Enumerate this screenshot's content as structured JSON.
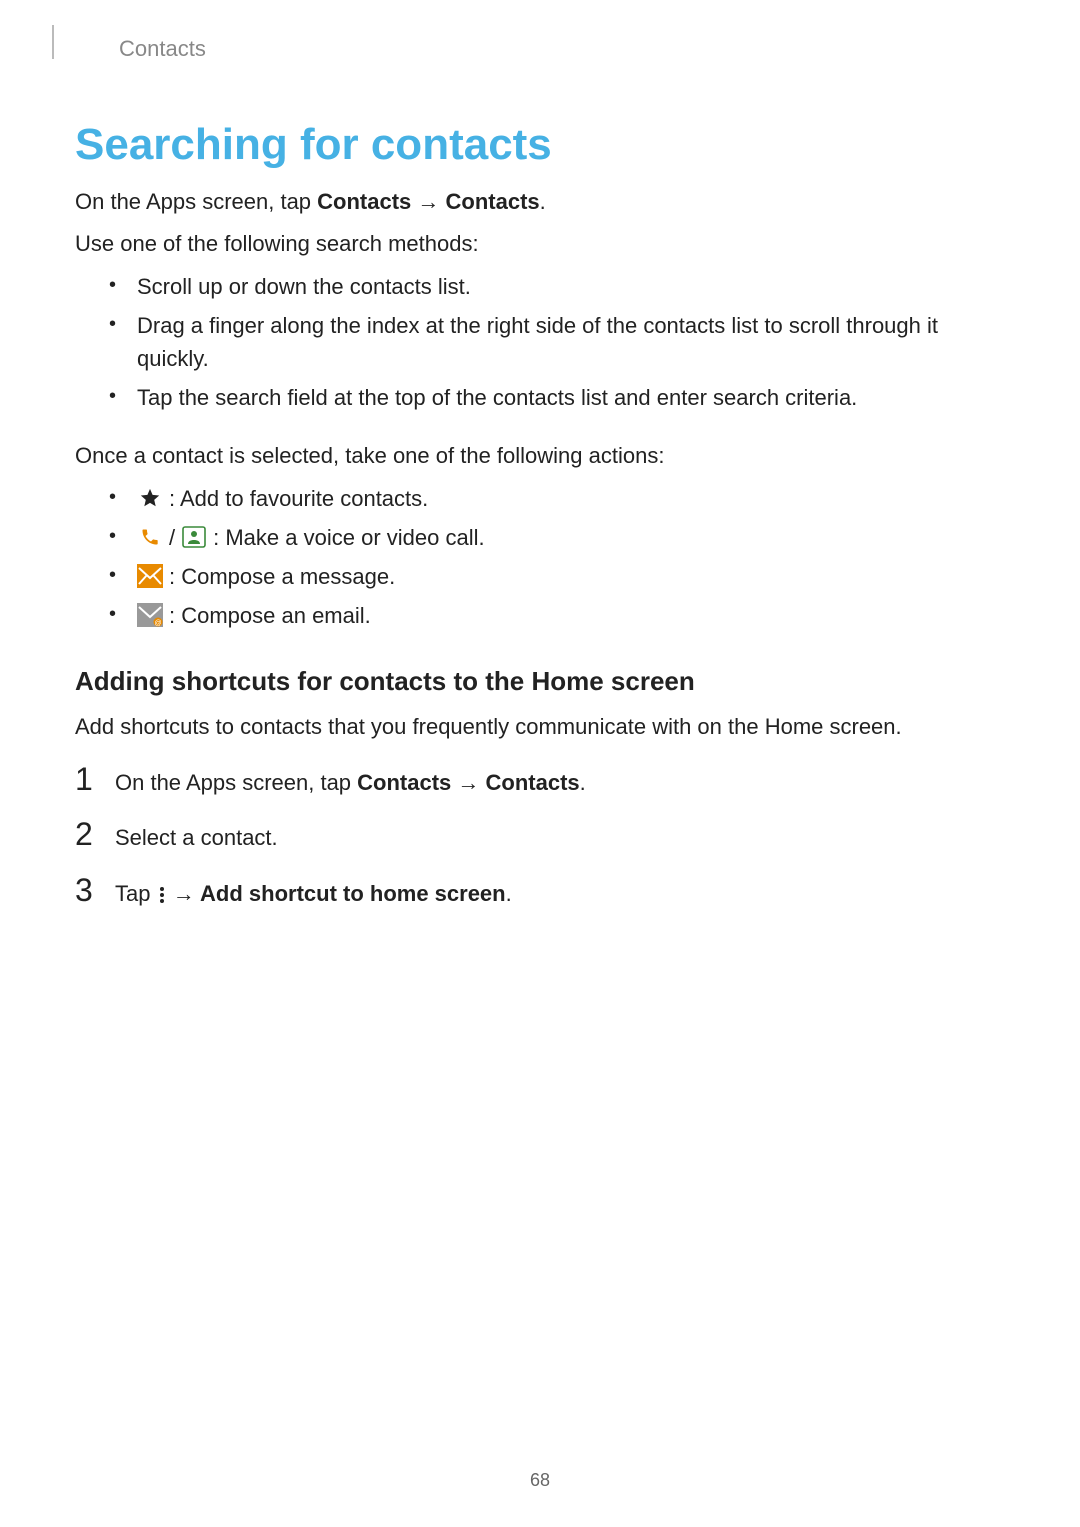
{
  "header": {
    "section": "Contacts"
  },
  "title": "Searching for contacts",
  "intro": {
    "line1_a": "On the Apps screen, tap ",
    "line1_b": "Contacts",
    "line1_c": " → ",
    "line1_d": "Contacts",
    "line1_e": ".",
    "line2": "Use one of the following search methods:"
  },
  "methods": [
    "Scroll up or down the contacts list.",
    "Drag a finger along the index at the right side of the contacts list to scroll through it quickly.",
    "Tap the search field at the top of the contacts list and enter search criteria."
  ],
  "actions_intro": "Once a contact is selected, take one of the following actions:",
  "actions": {
    "fav": " : Add to favourite contacts.",
    "call_sep": " / ",
    "call": " : Make a voice or video call.",
    "msg": " : Compose a message.",
    "email": " : Compose an email."
  },
  "subhead": "Adding shortcuts for contacts to the Home screen",
  "subintro": "Add shortcuts to contacts that you frequently communicate with on the Home screen.",
  "steps": {
    "s1": {
      "num": "1",
      "a": "On the Apps screen, tap ",
      "b": "Contacts",
      "c": " → ",
      "d": "Contacts",
      "e": "."
    },
    "s2": {
      "num": "2",
      "text": "Select a contact."
    },
    "s3": {
      "num": "3",
      "a": "Tap ",
      "b": " → ",
      "c": "Add shortcut to home screen",
      "d": "."
    }
  },
  "pagenum": "68"
}
